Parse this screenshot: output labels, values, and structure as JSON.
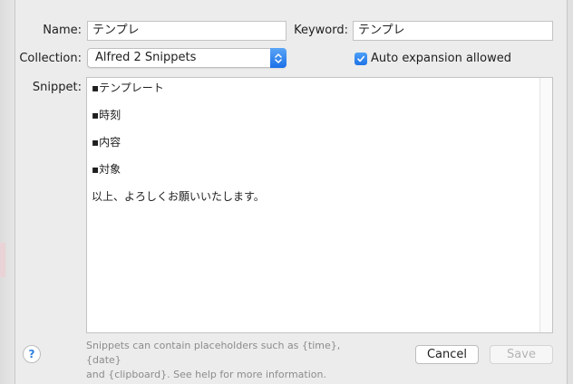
{
  "colors": {
    "accent": "#1f73e6",
    "footer_text": "#8c8c8c",
    "disabled_text": "#b4b4b4"
  },
  "form": {
    "name_label": "Name:",
    "name_value": "テンプレ",
    "keyword_label": "Keyword:",
    "keyword_value": "テンプレ",
    "collection_label": "Collection:",
    "collection_value": "Alfred 2 Snippets",
    "auto_expansion_label": "Auto expansion allowed",
    "auto_expansion_checked": true,
    "snippet_label": "Snippet:",
    "snippet_lines": [
      "▪テンプレート",
      "▪時刻",
      "▪内容",
      "▪対象",
      "以上、よろしくお願いいたします。"
    ]
  },
  "footer": {
    "help_label": "?",
    "help_icon": "question-mark-icon",
    "placeholder_hint_line1": "Snippets can contain placeholders such as {time}, {date}",
    "placeholder_hint_line2": "and {clipboard}. See help for more information.",
    "cancel_label": "Cancel",
    "save_label": "Save",
    "save_enabled": false
  }
}
